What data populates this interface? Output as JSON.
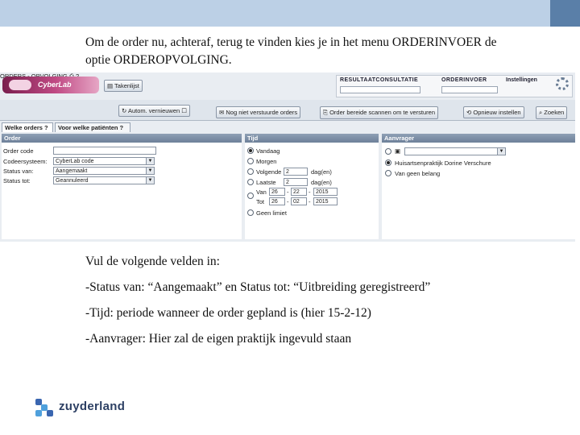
{
  "intro": {
    "line1": "Om de order nu, achteraf, terug te vinden kies je in het menu ORDERINVOER de",
    "line2": "optie ORDEROPVOLGING."
  },
  "app": {
    "logo": "CyberLab",
    "takenlijst": "Takenlijst",
    "nav": {
      "resultaat": "RESULTAATCONSULTATIE",
      "orderinvoer": "ORDERINVOER",
      "instellingen": "Instellingen"
    }
  },
  "toolbar": {
    "ordertab": "ORDERS - OPVOLGING",
    "autom": "Autom. vernieuwen",
    "nog_niet": "Nog niet verstuurde orders",
    "bereide": "Order bereide scannen om te versturen",
    "opnieuw": "Opnieuw instellen",
    "zoeken": "Zoeken"
  },
  "tabs": {
    "orders": "Welke orders ?",
    "patienten": "Voor welke patiënten ?"
  },
  "order": {
    "header": "Order",
    "fields": [
      {
        "label": "Order code",
        "value": ""
      },
      {
        "label": "Codeersysteem:",
        "value": "CyberLab code"
      },
      {
        "label": "Status van:",
        "value": "Aangemaakt"
      },
      {
        "label": "Status tot:",
        "value": "Geannuleerd"
      }
    ]
  },
  "tijd": {
    "header": "Tijd",
    "vandaag": "Vandaag",
    "morgen": "Morgen",
    "volgende": "Volgende",
    "volgende_val": "2",
    "dagen": "dag(en)",
    "laatste": "Laatste",
    "laatste_val": "2",
    "van": "Van",
    "tot": "Tot",
    "van_d": "26",
    "van_m": "22",
    "van_y": "2015",
    "tot_d": "26",
    "tot_m": "02",
    "tot_y": "2015",
    "geen": "Geen limiet"
  },
  "aanvrager": {
    "header": "Aanvrager",
    "opt2": "Huisartsenpraktijk Dorine Verschure",
    "opt3": "Van geen belang"
  },
  "body": {
    "l1": "Vul de volgende velden in:",
    "l2": "-Status van: “Aangemaakt” en Status tot: “Uitbreiding geregistreerd”",
    "l3": "-Tijd: periode wanneer de order gepland is (hier 15-2-12)",
    "l4": "-Aanvrager: Hier zal de eigen praktijk ingevuld staan"
  },
  "footer": {
    "brand": "zuyderland"
  }
}
